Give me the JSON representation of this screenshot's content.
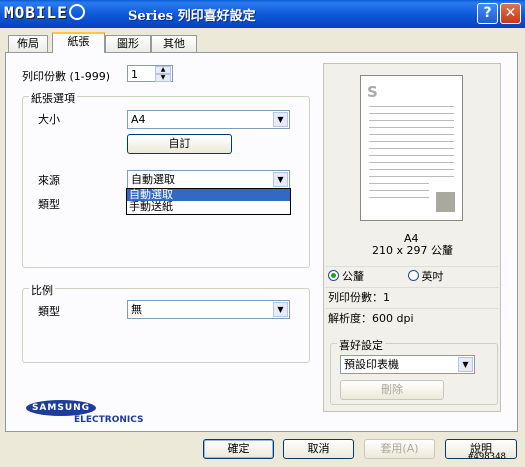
{
  "window": {
    "logo_text": "MOBILE",
    "title": "Series 列印喜好設定",
    "help_glyph": "?",
    "close_glyph": "✕"
  },
  "tabs": [
    {
      "label": "佈局"
    },
    {
      "label": "紙張"
    },
    {
      "label": "圖形"
    },
    {
      "label": "其他"
    }
  ],
  "copies": {
    "label": "列印份數 (1-999)",
    "value": "1"
  },
  "paper_options": {
    "group_title": "紙張選項",
    "size_label": "大小",
    "size_value": "A4",
    "custom_button": "自訂",
    "source_label": "來源",
    "source_value": "自動選取",
    "source_options": [
      "自動選取",
      "手動送紙"
    ],
    "type_label": "類型"
  },
  "scaling": {
    "group_title": "比例",
    "type_label": "類型",
    "type_value": "無"
  },
  "preview": {
    "paper_name": "A4",
    "paper_dims": "210 x 297 公釐",
    "paper_letter": "S",
    "unit_mm": "公釐",
    "unit_inch": "英吋",
    "copies_info": "列印份數：1",
    "resolution_info": "解析度：600 dpi"
  },
  "favorites": {
    "group_title": "喜好設定",
    "value": "預設印表機",
    "delete_button": "刪除"
  },
  "brand": {
    "name": "SAMSUNG",
    "sub": "ELECTRONICS"
  },
  "buttons": {
    "ok": "確定",
    "cancel": "取消",
    "apply": "套用(A)",
    "help": "說明"
  },
  "watermark": "#498348"
}
